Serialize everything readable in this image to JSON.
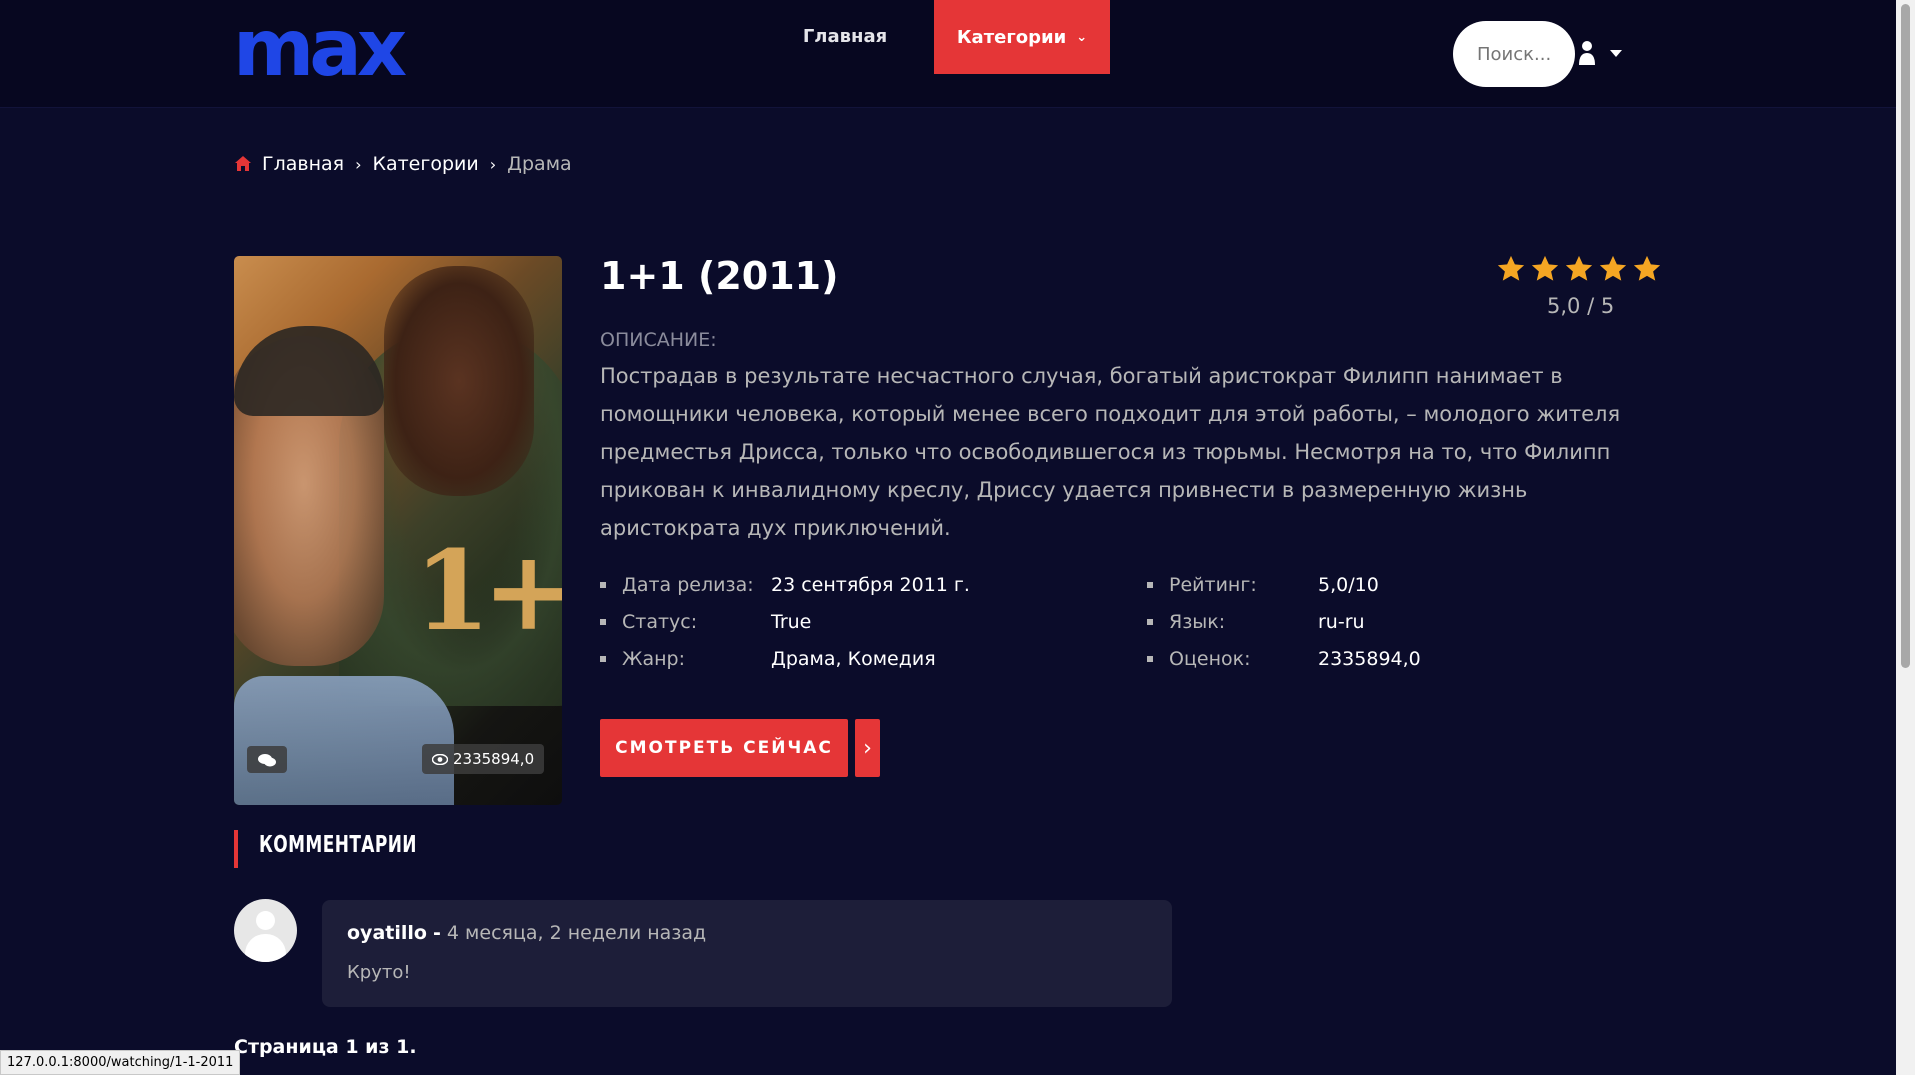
{
  "header": {
    "logo_text": "max",
    "nav": {
      "home_label": "Главная",
      "categories_label": "Категории"
    },
    "search": {
      "placeholder": "Поиск..."
    }
  },
  "breadcrumb": {
    "items": [
      "Главная",
      "Категории"
    ],
    "current": "Драма"
  },
  "movie": {
    "title": "1+1 (2011)",
    "poster_title": "1+1",
    "views": "2335894,0",
    "rating_stars": 5,
    "rating_text": "5,0 / 5",
    "description_label": "ОПИСАНИЕ:",
    "description": "Пострадав в результате несчастного случая, богатый аристократ Филипп нанимает в помощники человека, который менее всего подходит для этой работы, – молодого жителя предместья Дрисса, только что освободившегося из тюрьмы. Несмотря на то, что Филипп прикован к инвалидному креслу, Дриссу удается привнести в размеренную жизнь аристократа дух приключений.",
    "info_left": [
      {
        "key": "Дата релиза:",
        "value": "23 сентября 2011 г."
      },
      {
        "key": "Статус:",
        "value": "True"
      },
      {
        "key": "Жанр:",
        "value": "Драма, Комедия"
      }
    ],
    "info_right": [
      {
        "key": "Рейтинг:",
        "value": "5,0/10"
      },
      {
        "key": "Язык:",
        "value": "ru-ru"
      },
      {
        "key": "Оценок:",
        "value": "2335894,0"
      }
    ],
    "watch_label": "СМОТРЕТЬ СЕЙЧАС",
    "watch_arrow": "›"
  },
  "comments": {
    "section_title": "КОММЕНТАРИИ",
    "items": [
      {
        "user": "oyatillo",
        "dash": "-",
        "time": "4 месяца, 2 недели назад",
        "text": "Круто!"
      }
    ],
    "pager": "Страница 1 из 1."
  },
  "status_bar": {
    "url": "127.0.0.1:8000/watching/1-1-2011"
  },
  "colors": {
    "background": "#0b0c2a",
    "header": "#070720",
    "accent": "#e53637",
    "logo": "#1f46e6",
    "star": "#f5a623"
  }
}
